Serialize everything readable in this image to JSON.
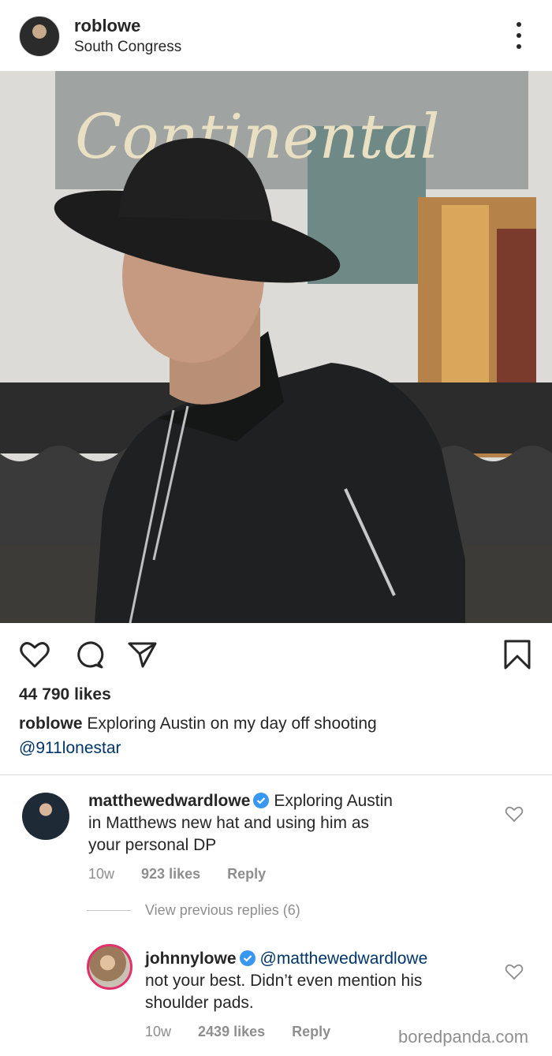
{
  "post": {
    "username": "roblowe",
    "location": "South Congress",
    "likes": "44 790 likes",
    "caption_user": "roblowe",
    "caption_text": "Exploring Austin on my day off shooting",
    "caption_mention": "@911lonestar",
    "sign_text": "Continental"
  },
  "comments": [
    {
      "username": "matthewedwardlowe",
      "verified": true,
      "text_line1": "Exploring Austin",
      "text_line2": "in Matthews new hat and using him as",
      "text_line3": "your personal DP",
      "age": "10w",
      "likes": "923 likes",
      "reply": "Reply"
    },
    {
      "username": "johnnylowe",
      "verified": true,
      "mention": "@matthewedwardlowe",
      "text_line2": "not your best. Didn’t even mention his",
      "text_line3": "shoulder pads.",
      "age": "10w",
      "likes": "2439 likes",
      "reply": "Reply"
    }
  ],
  "view_replies": "View previous replies (6)",
  "watermark": "boredpanda.com",
  "icons": [
    "heart-icon",
    "comment-icon",
    "share-icon",
    "bookmark-icon",
    "verified-icon",
    "more-icon"
  ],
  "colors": {
    "text": "#262626",
    "muted": "#8e8e8e",
    "verified": "#3897f0",
    "mention": "#003569"
  }
}
